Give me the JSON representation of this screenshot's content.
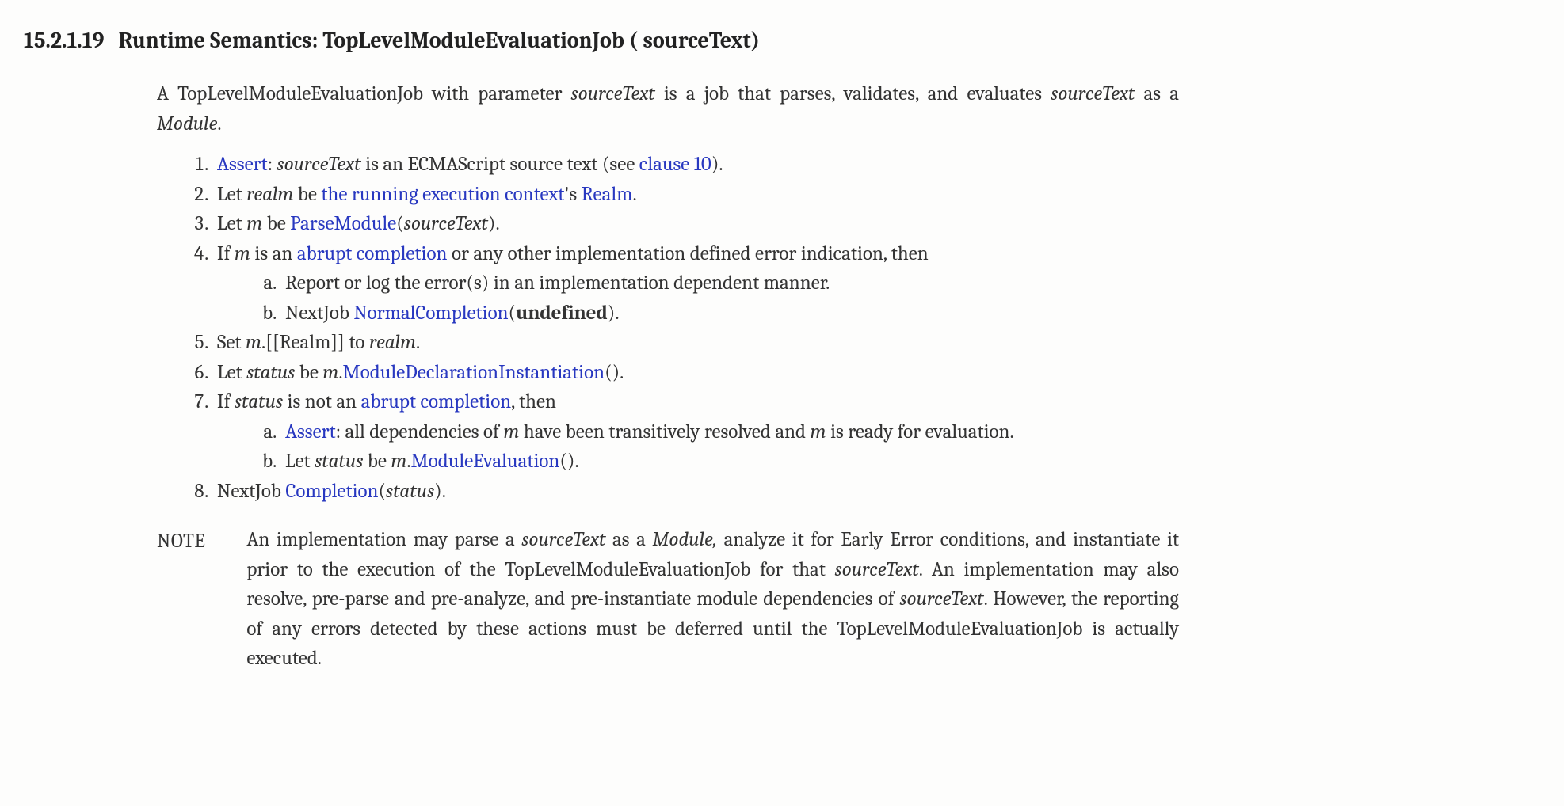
{
  "heading": {
    "number": "15.2.1.19",
    "title_prefix": "Runtime Semantics: TopLevelModuleEvaluationJob ( ",
    "title_param": "sourceText",
    "title_suffix": ")"
  },
  "intro": {
    "t1": "A TopLevelModuleEvaluationJob with parameter ",
    "p1": "sourceText",
    "t2": " is a job that parses, validates, and evaluates ",
    "p2": "sourceText",
    "t3": " as a ",
    "p3": "Module",
    "t4": "."
  },
  "alg": {
    "s1": {
      "link": "Assert",
      "t1": ": ",
      "v": "sourceText",
      "t2": " is an ECMAScript source text (see ",
      "link2": "clause 10",
      "t3": ")."
    },
    "s2": {
      "t1": "Let ",
      "v": "realm",
      "t2": " be ",
      "link1": "the running execution context",
      "t3": "'s ",
      "link2": "Realm",
      "t4": "."
    },
    "s3": {
      "t1": "Let ",
      "v": "m",
      "t2": " be ",
      "link": "ParseModule",
      "t3": "(",
      "v2": "sourceText",
      "t4": ")."
    },
    "s4": {
      "t1": "If ",
      "v": "m",
      "t2": " is an ",
      "link": "abrupt completion",
      "t3": " or any other implementation defined error indication, then",
      "a": "Report or log the error(s) in an implementation dependent manner.",
      "b_t1": "NextJob ",
      "b_link": "NormalCompletion",
      "b_t2": "(",
      "b_bold": "undefined",
      "b_t3": ")."
    },
    "s5": {
      "t1": "Set ",
      "v1": "m",
      "t2": ".[[Realm]] to ",
      "v2": "realm",
      "t3": "."
    },
    "s6": {
      "t1": "Let ",
      "v1": "status",
      "t2": " be ",
      "v2": "m",
      "t3": ".",
      "link": "ModuleDeclarationInstantiation",
      "t4": "()."
    },
    "s7": {
      "t1": "If ",
      "v": "status",
      "t2": " is not an ",
      "link": "abrupt completion",
      "t3": ", then",
      "a_link": "Assert",
      "a_t1": ": all dependencies of ",
      "a_v1": "m",
      "a_t2": " have been transitively resolved and ",
      "a_v2": "m",
      "a_t3": " is ready for evaluation.",
      "b_t1": "Let ",
      "b_v1": "status",
      "b_t2": " be ",
      "b_v2": "m",
      "b_t3": ".",
      "b_link": "ModuleEvaluation",
      "b_t4": "()."
    },
    "s8": {
      "t1": "NextJob ",
      "link": "Completion",
      "t2": "(",
      "v": "status",
      "t3": ")."
    }
  },
  "note": {
    "label": "NOTE",
    "t1": "An implementation may parse a ",
    "v1": "sourceText",
    "t2": " as a ",
    "v2": "Module,",
    "t3": " analyze it for Early Error conditions, and instantiate it prior to the execution of the TopLevelModuleEvaluationJob for that ",
    "v3": "sourceText",
    "t4": ". An implementation may also resolve, pre-parse and pre-analyze, and pre-instantiate module dependencies of ",
    "v4": "sourceText",
    "t5": ". However, the reporting of any errors detected by these actions must be deferred until the TopLevelModuleEvaluationJob is actually executed."
  }
}
